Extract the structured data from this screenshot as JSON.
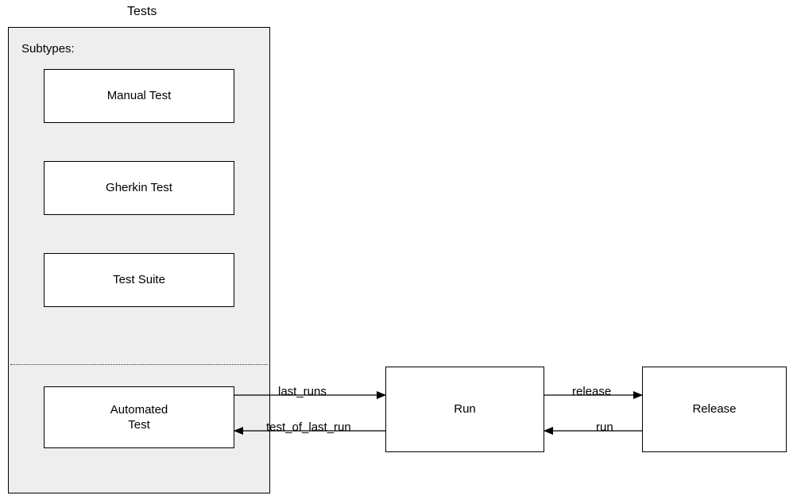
{
  "diagram": {
    "title": "Tests",
    "subtypes_label": "Subtypes:",
    "subtypes": [
      "Manual Test",
      "Gherkin Test",
      "Test Suite"
    ],
    "automated_test": "Automated\nTest",
    "run_box": "Run",
    "release_box": "Release",
    "edges": {
      "last_runs": "last_runs",
      "test_of_last_run": "test_of_last_run",
      "release": "release",
      "run": "run"
    }
  }
}
